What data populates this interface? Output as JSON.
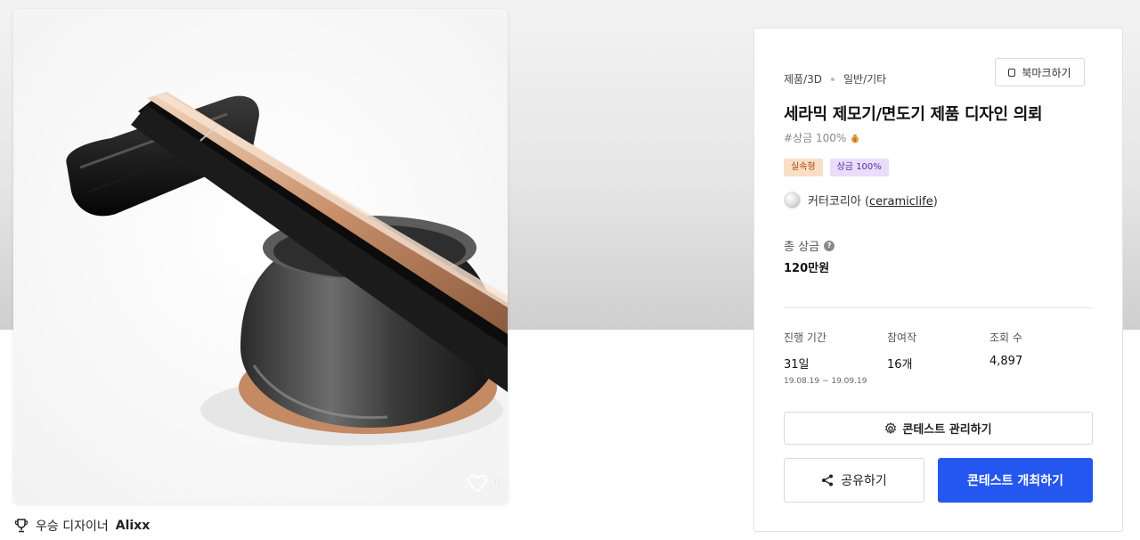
{
  "product_image": {
    "likes": "9",
    "heart_icon": "heart-outline-icon"
  },
  "winner": {
    "icon": "trophy-icon",
    "label": "우승 디자이너",
    "name": "Alixx"
  },
  "panel": {
    "bookmark_label": "북마크하기",
    "category_main": "제품/3D",
    "category_sub": "일반/기타",
    "title": "세라믹 제모기/면도기 제품 디자인 의뢰",
    "hashtag": "#상금 100%",
    "tags": {
      "type": "실속형",
      "prize": "상금 100%"
    },
    "host": {
      "name": "커터코리아",
      "paren_open": "(",
      "handle": "ceramiclife",
      "paren_close": ")"
    },
    "prize_label": "총 상금",
    "prize_value": "120만원",
    "stats": {
      "period_label": "진행 기간",
      "period_value": "31일",
      "period_range": "19.08.19 ~ 19.09.19",
      "entries_label": "참여작",
      "entries_value": "16개",
      "views_label": "조회 수",
      "views_value": "4,897"
    },
    "manage_label": "콘테스트 관리하기",
    "share_label": "공유하기",
    "host_contest_label": "콘테스트 개최하기"
  },
  "colors": {
    "primary": "#2456f0",
    "tag_type_bg": "#f8dfc6",
    "tag_prize_bg": "#eadcfb"
  }
}
